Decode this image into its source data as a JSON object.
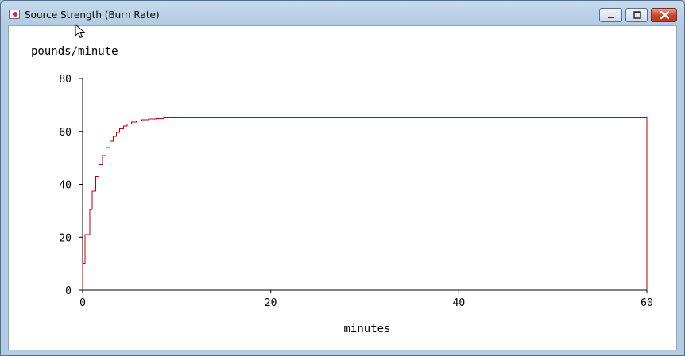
{
  "window": {
    "title": "Source Strength (Burn Rate)",
    "icon": "app-icon",
    "buttons": [
      "minimize-icon",
      "maximize-icon",
      "close-icon"
    ]
  },
  "chart_data": {
    "type": "line",
    "line_style": "step",
    "title": "",
    "ylabel": "pounds/minute",
    "xlabel": "minutes",
    "xlim": [
      0,
      60
    ],
    "ylim": [
      0,
      80
    ],
    "x_ticks": [
      0,
      20,
      40,
      60
    ],
    "y_ticks": [
      0,
      20,
      40,
      60,
      80
    ],
    "grid": false,
    "color": "#c00000",
    "series": [
      {
        "x": [
          0,
          0.25,
          0.75,
          1.0,
          1.4,
          1.75,
          2.1,
          2.5,
          2.9,
          3.25,
          3.6,
          3.95,
          4.35,
          4.75,
          5.2,
          5.7,
          6.3,
          7.0,
          7.8,
          8.6,
          60
        ],
        "y": [
          10,
          21,
          30.5,
          37.5,
          43,
          47.5,
          51,
          54,
          56.3,
          58.1,
          59.6,
          60.9,
          62.0,
          62.8,
          63.5,
          64.0,
          64.4,
          64.7,
          64.9,
          65.2,
          0
        ]
      }
    ]
  }
}
